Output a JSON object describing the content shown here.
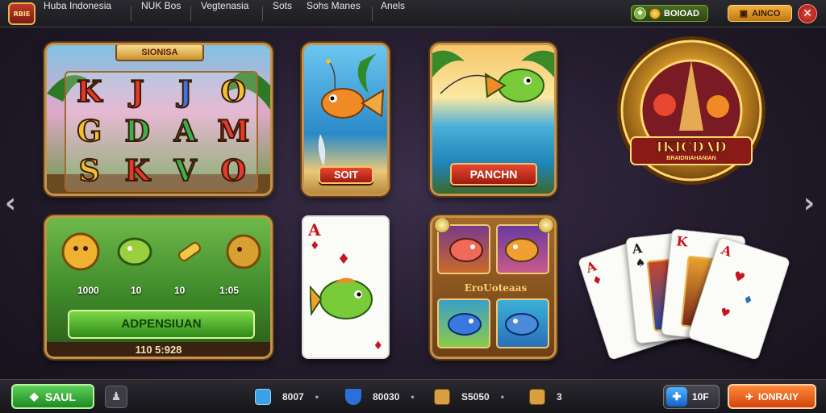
{
  "header": {
    "logo_text": "RBIE",
    "nav": [
      "Huba Indonesia",
      "NUK Bos",
      "Vegtenasia",
      "Sots",
      "Sohs Manes",
      "Anels"
    ],
    "balance": "BOIOAD",
    "add_label": "AINCO",
    "close_label": "✕"
  },
  "games": {
    "slot": {
      "banner": "SIONISA",
      "symbols": [
        "K",
        "J",
        "J",
        "O",
        "G",
        "D",
        "A",
        "M",
        "S",
        "K",
        "V",
        "O"
      ]
    },
    "fish1": {
      "button": "SOIT"
    },
    "fish2": {
      "button": "PANCHN"
    },
    "coin": {
      "values": [
        "1000",
        "10",
        "10",
        "1:05"
      ],
      "button": "ADPENSIUAN",
      "footer": "110 5:928"
    },
    "card": {
      "rank": "A"
    },
    "grid": {
      "label": "EroUoteaas"
    },
    "jackpot": {
      "title": "IKICDAD",
      "subtitle": "BRAIDNIAHANIAN"
    },
    "fan_cards": [
      "A",
      "A",
      "K",
      "A"
    ]
  },
  "footer": {
    "sell_label": "SAUL",
    "stats": [
      {
        "value": "8007",
        "icon": "tv-icon",
        "color": "#3aa0e8"
      },
      {
        "value": "80030",
        "icon": "shield-icon",
        "color": "#2a70d8"
      },
      {
        "value": "S5050",
        "icon": "box-icon",
        "color": "#d8a040"
      },
      {
        "value": "3",
        "icon": "card-icon",
        "color": "#d8a040"
      }
    ],
    "blue_value": "10F",
    "orange_label": "IONRAIY"
  },
  "colors": {
    "gold": "#c8924a",
    "red_button": "#e8472f",
    "green_button": "#2d8a18",
    "orange_button": "#d2450c"
  }
}
